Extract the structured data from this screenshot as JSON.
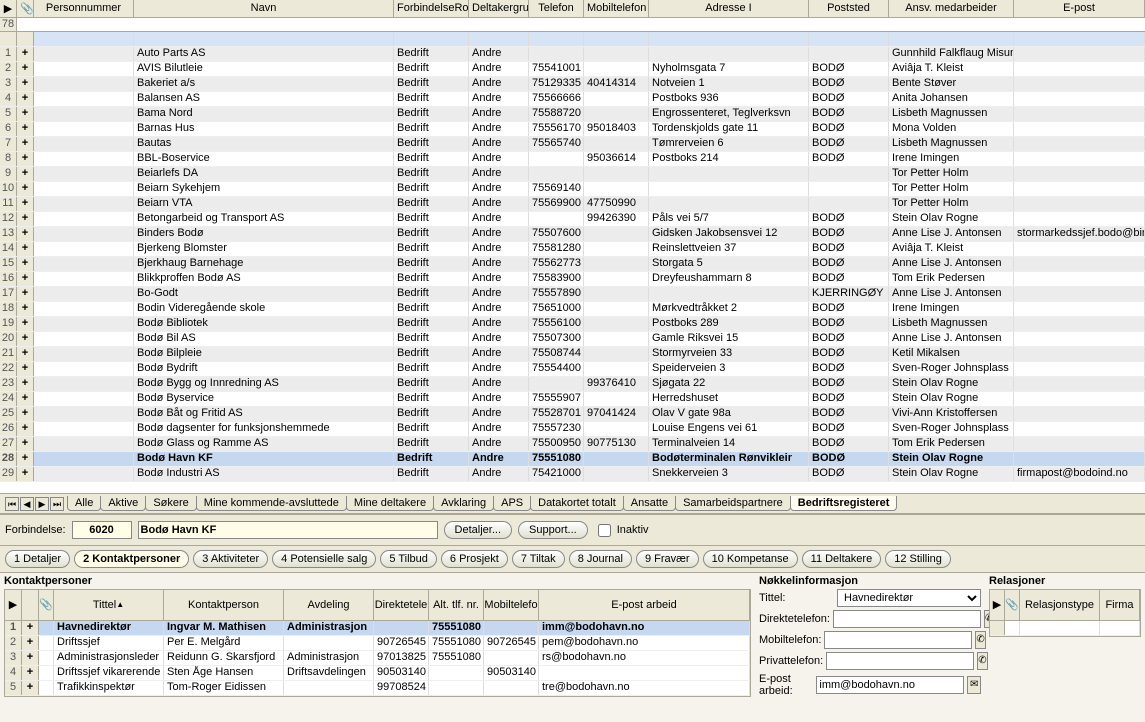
{
  "main_grid": {
    "start_row_num": 78,
    "headers": [
      "",
      "",
      "Personnummer",
      "Navn",
      "ForbindelseRo",
      "Deltakergru",
      "Telefon",
      "Mobiltelefon",
      "Adresse I",
      "Poststed",
      "Ansv. medarbeider",
      "E-post"
    ],
    "rows": [
      {
        "n": "",
        "navn": "",
        "forb": "",
        "delt": "",
        "tel": "",
        "mob": "",
        "adr": "",
        "post": "",
        "ansv": "",
        "epost": ""
      },
      {
        "navn": "Auto Parts AS",
        "forb": "Bedrift",
        "delt": "Andre",
        "tel": "",
        "mob": "",
        "adr": "",
        "post": "",
        "ansv": "Gunnhild Falkflaug Misun",
        "epost": ""
      },
      {
        "navn": "AVIS Bilutleie",
        "forb": "Bedrift",
        "delt": "Andre",
        "tel": "75541001",
        "mob": "",
        "adr": "Nyholmsgata 7",
        "post": "BODØ",
        "ansv": "Aviâja T. Kleist",
        "epost": ""
      },
      {
        "navn": "Bakeriet a/s",
        "forb": "Bedrift",
        "delt": "Andre",
        "tel": "75129335",
        "mob": "40414314",
        "adr": "Notveien 1",
        "post": "BODØ",
        "ansv": "Bente Støver",
        "epost": ""
      },
      {
        "navn": "Balansen AS",
        "forb": "Bedrift",
        "delt": "Andre",
        "tel": "75566666",
        "mob": "",
        "adr": "Postboks 936",
        "post": "BODØ",
        "ansv": "Anita Johansen",
        "epost": ""
      },
      {
        "navn": "Bama Nord",
        "forb": "Bedrift",
        "delt": "Andre",
        "tel": "75588720",
        "mob": "",
        "adr": "Engrossenteret, Teglverksvn",
        "post": "BODØ",
        "ansv": "Lisbeth Magnussen",
        "epost": ""
      },
      {
        "navn": "Barnas Hus",
        "forb": "Bedrift",
        "delt": "Andre",
        "tel": "75556170",
        "mob": "95018403",
        "adr": "Tordenskjolds gate 11",
        "post": "BODØ",
        "ansv": "Mona Volden",
        "epost": ""
      },
      {
        "navn": "Bautas",
        "forb": "Bedrift",
        "delt": "Andre",
        "tel": "75565740",
        "mob": "",
        "adr": "Tømrerveien 6",
        "post": "BODØ",
        "ansv": "Lisbeth Magnussen",
        "epost": ""
      },
      {
        "navn": "BBL-Boservice",
        "forb": "Bedrift",
        "delt": "Andre",
        "tel": "",
        "mob": "95036614",
        "adr": "Postboks 214",
        "post": "BODØ",
        "ansv": "Irene Imingen",
        "epost": ""
      },
      {
        "navn": "Beiarlefs DA",
        "forb": "Bedrift",
        "delt": "Andre",
        "tel": "",
        "mob": "",
        "adr": "",
        "post": "",
        "ansv": "Tor Petter Holm",
        "epost": ""
      },
      {
        "navn": "Beiarn Sykehjem",
        "forb": "Bedrift",
        "delt": "Andre",
        "tel": "75569140",
        "mob": "",
        "adr": "",
        "post": "",
        "ansv": "Tor Petter Holm",
        "epost": ""
      },
      {
        "navn": "Beiarn VTA",
        "forb": "Bedrift",
        "delt": "Andre",
        "tel": "75569900",
        "mob": "47750990",
        "adr": "",
        "post": "",
        "ansv": "Tor Petter Holm",
        "epost": ""
      },
      {
        "navn": "Betongarbeid og Transport AS",
        "forb": "Bedrift",
        "delt": "Andre",
        "tel": "",
        "mob": "99426390",
        "adr": "Påls vei 5/7",
        "post": "BODØ",
        "ansv": "Stein Olav Rogne",
        "epost": ""
      },
      {
        "navn": "Binders Bodø",
        "forb": "Bedrift",
        "delt": "Andre",
        "tel": "75507600",
        "mob": "",
        "adr": "Gidsken Jakobsensvei 12",
        "post": "BODØ",
        "ansv": "Anne Lise J. Antonsen",
        "epost": "stormarkedssjef.bodo@bir"
      },
      {
        "navn": "Bjerkeng Blomster",
        "forb": "Bedrift",
        "delt": "Andre",
        "tel": "75581280",
        "mob": "",
        "adr": "Reinslettveien 37",
        "post": "BODØ",
        "ansv": "Aviâja T. Kleist",
        "epost": ""
      },
      {
        "navn": "Bjerkhaug Barnehage",
        "forb": "Bedrift",
        "delt": "Andre",
        "tel": "75562773",
        "mob": "",
        "adr": "Storgata 5",
        "post": "BODØ",
        "ansv": "Anne Lise J. Antonsen",
        "epost": ""
      },
      {
        "navn": "Blikkproffen Bodø AS",
        "forb": "Bedrift",
        "delt": "Andre",
        "tel": "75583900",
        "mob": "",
        "adr": "Dreyfeushammarn 8",
        "post": "BODØ",
        "ansv": "Tom Erik Pedersen",
        "epost": ""
      },
      {
        "navn": "Bo-Godt",
        "forb": "Bedrift",
        "delt": "Andre",
        "tel": "75557890",
        "mob": "",
        "adr": "",
        "post": "KJERRINGØY",
        "ansv": "Anne Lise J. Antonsen",
        "epost": ""
      },
      {
        "navn": "Bodin Videregående skole",
        "forb": "Bedrift",
        "delt": "Andre",
        "tel": "75651000",
        "mob": "",
        "adr": "Mørkvedtråkket 2",
        "post": "BODØ",
        "ansv": "Irene Imingen",
        "epost": ""
      },
      {
        "navn": "Bodø Bibliotek",
        "forb": "Bedrift",
        "delt": "Andre",
        "tel": "75556100",
        "mob": "",
        "adr": "Postboks 289",
        "post": "BODØ",
        "ansv": "Lisbeth Magnussen",
        "epost": ""
      },
      {
        "navn": "Bodø Bil AS",
        "forb": "Bedrift",
        "delt": "Andre",
        "tel": "75507300",
        "mob": "",
        "adr": "Gamle Riksvei 15",
        "post": "BODØ",
        "ansv": "Anne Lise J. Antonsen",
        "epost": ""
      },
      {
        "navn": "Bodø Bilpleie",
        "forb": "Bedrift",
        "delt": "Andre",
        "tel": "75508744",
        "mob": "",
        "adr": "Stormyrveien 33",
        "post": "BODØ",
        "ansv": "Ketil Mikalsen",
        "epost": ""
      },
      {
        "navn": "Bodø Bydrift",
        "forb": "Bedrift",
        "delt": "Andre",
        "tel": "75554400",
        "mob": "",
        "adr": "Speiderveien 3",
        "post": "BODØ",
        "ansv": "Sven-Roger Johnsplass",
        "epost": ""
      },
      {
        "navn": "Bodø Bygg og Innredning AS",
        "forb": "Bedrift",
        "delt": "Andre",
        "tel": "",
        "mob": "99376410",
        "adr": "Sjøgata 22",
        "post": "BODØ",
        "ansv": "Stein Olav Rogne",
        "epost": ""
      },
      {
        "navn": "Bodø Byservice",
        "forb": "Bedrift",
        "delt": "Andre",
        "tel": "75555907",
        "mob": "",
        "adr": "Herredshuset",
        "post": "BODØ",
        "ansv": "Stein Olav Rogne",
        "epost": ""
      },
      {
        "navn": "Bodø Båt og Fritid AS",
        "forb": "Bedrift",
        "delt": "Andre",
        "tel": "75528701",
        "mob": "97041424",
        "adr": "Olav V gate 98a",
        "post": "BODØ",
        "ansv": "Vivi-Ann Kristoffersen",
        "epost": ""
      },
      {
        "navn": "Bodø dagsenter for funksjonshemmede",
        "forb": "Bedrift",
        "delt": "Andre",
        "tel": "75557230",
        "mob": "",
        "adr": "Louise Engens vei 61",
        "post": "BODØ",
        "ansv": "Sven-Roger Johnsplass",
        "epost": ""
      },
      {
        "navn": "Bodø Glass og Ramme AS",
        "forb": "Bedrift",
        "delt": "Andre",
        "tel": "75500950",
        "mob": "90775130",
        "adr": "Terminalveien 14",
        "post": "BODØ",
        "ansv": "Tom Erik Pedersen",
        "epost": ""
      },
      {
        "navn": "Bodø Havn KF",
        "forb": "Bedrift",
        "delt": "Andre",
        "tel": "75551080",
        "mob": "",
        "adr": "Bodøterminalen Rønvikleir",
        "post": "BODØ",
        "ansv": "Stein Olav Rogne",
        "epost": "",
        "selected": true
      },
      {
        "navn": "Bodø Industri AS",
        "forb": "Bedrift",
        "delt": "Andre",
        "tel": "75421000",
        "mob": "",
        "adr": "Snekkerveien 3",
        "post": "BODØ",
        "ansv": "Stein Olav Rogne",
        "epost": "firmapost@bodoind.no"
      }
    ]
  },
  "worksheet_tabs": [
    "Alle",
    "Aktive",
    "Søkere",
    "Mine kommende-avsluttede",
    "Mine deltakere",
    "Avklaring",
    "APS",
    "Datakortet totalt",
    "Ansatte",
    "Samarbeidspartnere",
    "Bedriftsregisteret"
  ],
  "worksheet_active": 10,
  "detail": {
    "label": "Forbindelse:",
    "code": "6020",
    "name": "Bodø Havn KF",
    "btn_details": "Detaljer...",
    "btn_support": "Support...",
    "chk_inaktiv": "Inaktiv"
  },
  "detail_tabs": [
    "1 Detaljer",
    "2 Kontaktpersoner",
    "3 Aktiviteter",
    "4 Potensielle salg",
    "5 Tilbud",
    "6 Prosjekt",
    "7 Tiltak",
    "8 Journal",
    "9 Fravær",
    "10 Kompetanse",
    "11 Deltakere",
    "12 Stilling"
  ],
  "detail_tab_active": 1,
  "contacts": {
    "title": "Kontaktpersoner",
    "headers": [
      "",
      "",
      "",
      "Tittel",
      "Kontaktperson",
      "Avdeling",
      "Direktetele",
      "Alt. tlf. nr.",
      "Mobiltelefo",
      "E-post arbeid"
    ],
    "rows": [
      {
        "n": "1",
        "tittel": "Havnedirektør",
        "kontakt": "Ingvar M. Mathisen",
        "avd": "Administrasjon",
        "dir": "",
        "alt": "75551080",
        "mob": "",
        "epost": "imm@bodohavn.no",
        "selected": true
      },
      {
        "n": "2",
        "tittel": "Driftssjef",
        "kontakt": "Per E. Melgård",
        "avd": "",
        "dir": "90726545",
        "alt": "75551080",
        "mob": "90726545",
        "epost": "pem@bodohavn.no"
      },
      {
        "n": "3",
        "tittel": "Administrasjonsleder",
        "kontakt": "Reidunn G. Skarsfjord",
        "avd": "Administrasjon",
        "dir": "97013825",
        "alt": "75551080",
        "mob": "",
        "epost": "rs@bodohavn.no"
      },
      {
        "n": "4",
        "tittel": "Driftssjef vikarerende",
        "kontakt": "Sten Åge Hansen",
        "avd": "Driftsavdelingen",
        "dir": "90503140",
        "alt": "",
        "mob": "90503140",
        "epost": ""
      },
      {
        "n": "5",
        "tittel": "Trafikkinspektør",
        "kontakt": "Tom-Roger Eidissen",
        "avd": "",
        "dir": "99708524",
        "alt": "",
        "mob": "",
        "epost": "tre@bodohavn.no"
      }
    ]
  },
  "key_info": {
    "title": "Nøkkelinformasjon",
    "fields": {
      "tittel_label": "Tittel:",
      "tittel_value": "Havnedirektør",
      "dir_label": "Direktetelefon:",
      "mob_label": "Mobiltelefon:",
      "priv_label": "Privattelefon:",
      "epost_label": "E-post arbeid:",
      "epost_value": "imm@bodohavn.no"
    }
  },
  "relations": {
    "title": "Relasjoner",
    "headers": [
      "Relasjonstype",
      "Firma"
    ]
  }
}
